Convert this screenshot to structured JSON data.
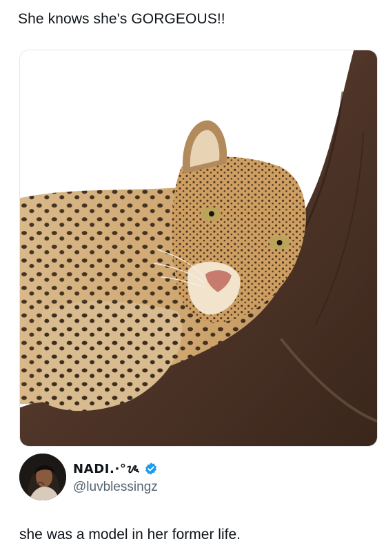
{
  "quote": {
    "caption": "She knows she's GORGEOUS!!"
  },
  "author": {
    "display_name": "NADI.·°ᝰ",
    "handle": "@luvblessingz",
    "verified": true
  },
  "tweet": {
    "text": "she was a model in her former life."
  },
  "icons": {
    "verified": "verified-badge-icon"
  },
  "colors": {
    "verified_badge": "#1d9bf0",
    "handle": "#536471",
    "text": "#0f1419"
  }
}
